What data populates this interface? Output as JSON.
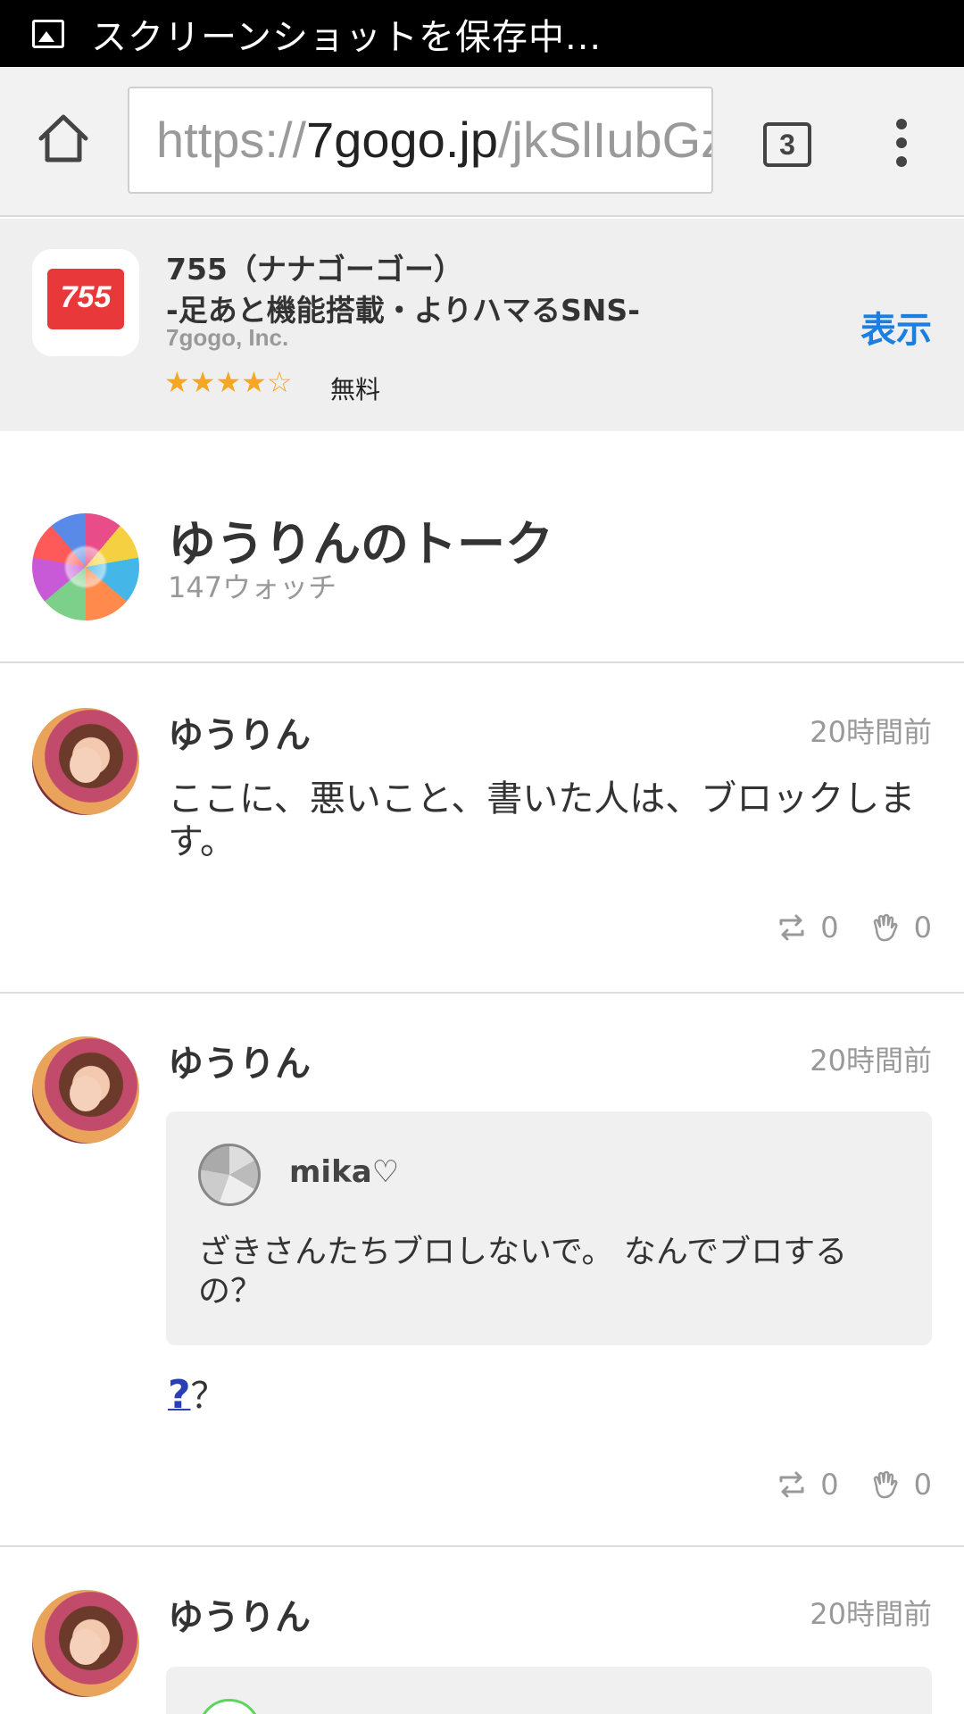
{
  "status_bar": {
    "title": "スクリーンショットを保存中..."
  },
  "toolbar": {
    "url_scheme": "https://",
    "url_host": "7gogo.jp",
    "url_path": "/jkSlIubGz",
    "tab_count": "3"
  },
  "app_banner": {
    "icon_text": "755",
    "name_line1": "755（ナナゴーゴー）",
    "name_line2": "-足あと機能搭載・よりハマるSNS-",
    "developer": "7gogo, Inc.",
    "rating": 4,
    "rating_max": 5,
    "stars_text": "★★★★☆",
    "price": "無料",
    "view_label": "表示",
    "accent_color": "#1a7fe0"
  },
  "talk": {
    "title": "ゆうりんのトーク",
    "watch_count": "147ウォッチ"
  },
  "posts": [
    {
      "author": "ゆうりん",
      "time": "20時間前",
      "body": "ここに、悪いこと、書いた人は、ブロックします。",
      "repost_count": "0",
      "like_count": "0"
    },
    {
      "author": "ゆうりん",
      "time": "20時間前",
      "quote": {
        "name": "mika♡",
        "text": "ざきさんたちブロしないで。 なんでブロするの？"
      },
      "body_emoji": "?",
      "body": "？",
      "repost_count": "0",
      "like_count": "0"
    },
    {
      "author": "ゆうりん",
      "time": "20時間前"
    }
  ]
}
